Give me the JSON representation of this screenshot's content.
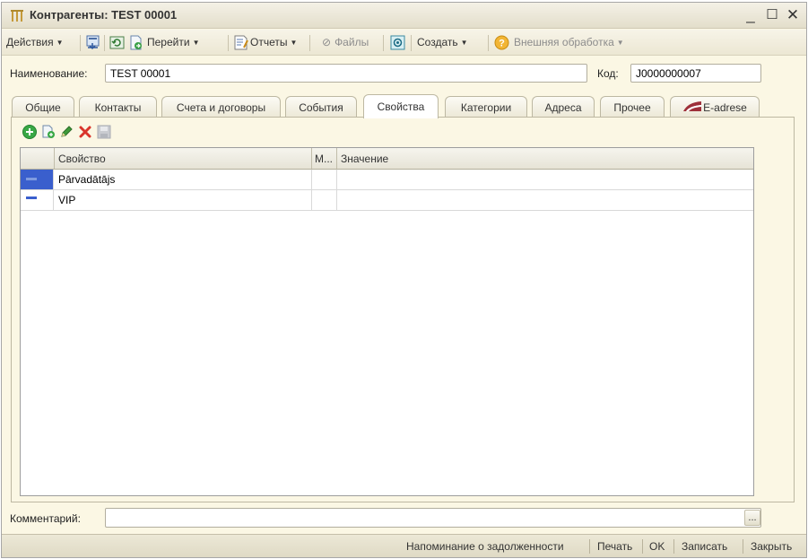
{
  "window": {
    "title": "Контрагенты: TEST 00001"
  },
  "toolbar": {
    "actions": "Действия",
    "goto": "Перейти",
    "reports": "Отчеты",
    "files": "Файлы",
    "create": "Создать",
    "external": "Внешняя обработка"
  },
  "form": {
    "name_label": "Наименование:",
    "name_value": "TEST 00001",
    "code_label": "Код:",
    "code_value": "J0000000007",
    "comment_label": "Комментарий:",
    "comment_value": "",
    "comment_button": "..."
  },
  "tabs": [
    {
      "label": "Общие"
    },
    {
      "label": "Контакты"
    },
    {
      "label": "Счета и договоры"
    },
    {
      "label": "События"
    },
    {
      "label": "Свойства",
      "active": true
    },
    {
      "label": "Категории"
    },
    {
      "label": "Адреса"
    },
    {
      "label": "Прочее"
    },
    {
      "label": "E-adrese"
    }
  ],
  "grid": {
    "columns": [
      "Свойство",
      "М...",
      "Значение"
    ],
    "rows": [
      {
        "property": "Pārvadātājs",
        "m": "",
        "value": ""
      },
      {
        "property": "VIP",
        "m": "",
        "value": ""
      }
    ]
  },
  "statusbar": {
    "reminder": "Напоминание о задолженности",
    "print": "Печать",
    "ok": "OK",
    "save": "Записать",
    "close": "Закрыть"
  },
  "colors": {
    "window_bg": "#fbf7e4",
    "selected_row_marker": "#3a5fcd",
    "delete_red": "#d9342b",
    "add_green": "#39a845"
  }
}
